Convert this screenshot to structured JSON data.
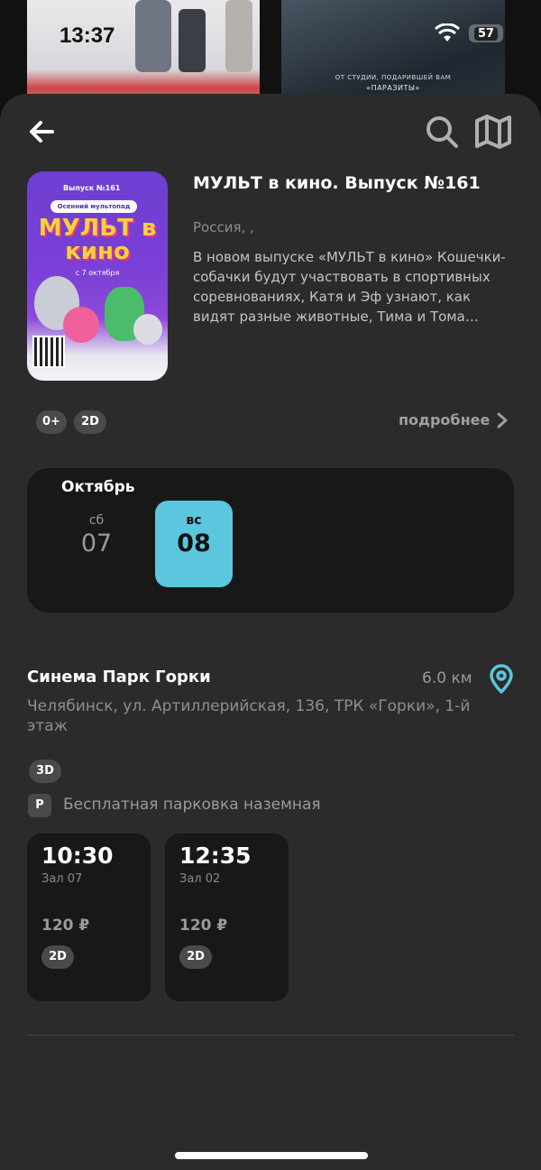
{
  "status_bar": {
    "time": "13:37",
    "battery": "57"
  },
  "background_posters": {
    "right_caption_line1": "ОТ СТУДИИ, ПОДАРИВШЕЙ ВАМ",
    "right_caption_line2": "«ПАРАЗИТЫ»"
  },
  "toolbar": {
    "back_icon": "arrow-left-icon",
    "search_icon": "search-icon",
    "map_icon": "map-icon"
  },
  "movie": {
    "title": "МУЛЬТ в кино. Выпуск №161",
    "country": "Россия, ,",
    "description": "В новом выпуске «МУЛЬТ в кино» Кошечки-собачки будут участвовать в спортивных соревнованиях, Катя и Эф узнают, как видят разные животные, Тима и Тома помогут друзьям, а Фиксики расскажут много интересного.",
    "poster": {
      "issue": "Выпуск №161",
      "subtitle": "Осенний мультопад",
      "title": "МУЛЬТ в кино",
      "date": "с 7 октября"
    },
    "age_rating": "0+",
    "format": "2D",
    "more_label": "подробнее"
  },
  "schedule": {
    "month": "Октябрь",
    "days": [
      {
        "dow": "сб",
        "num": "07",
        "selected": false
      },
      {
        "dow": "вс",
        "num": "08",
        "selected": true
      }
    ],
    "accent_color": "#5bc6dd"
  },
  "cinema": {
    "name": "Синема Парк Горки",
    "distance": "6.0 км",
    "address": "Челябинск, ул. Артиллерийская, 136, ТРК «Горки», 1-й этаж",
    "format_badge": "3D",
    "parking_icon": "P",
    "parking_text": "Бесплатная парковка наземная",
    "sessions": [
      {
        "time": "10:30",
        "hall": "Зал 07",
        "price": "120 ₽",
        "format": "2D"
      },
      {
        "time": "12:35",
        "hall": "Зал 02",
        "price": "120 ₽",
        "format": "2D"
      }
    ]
  }
}
